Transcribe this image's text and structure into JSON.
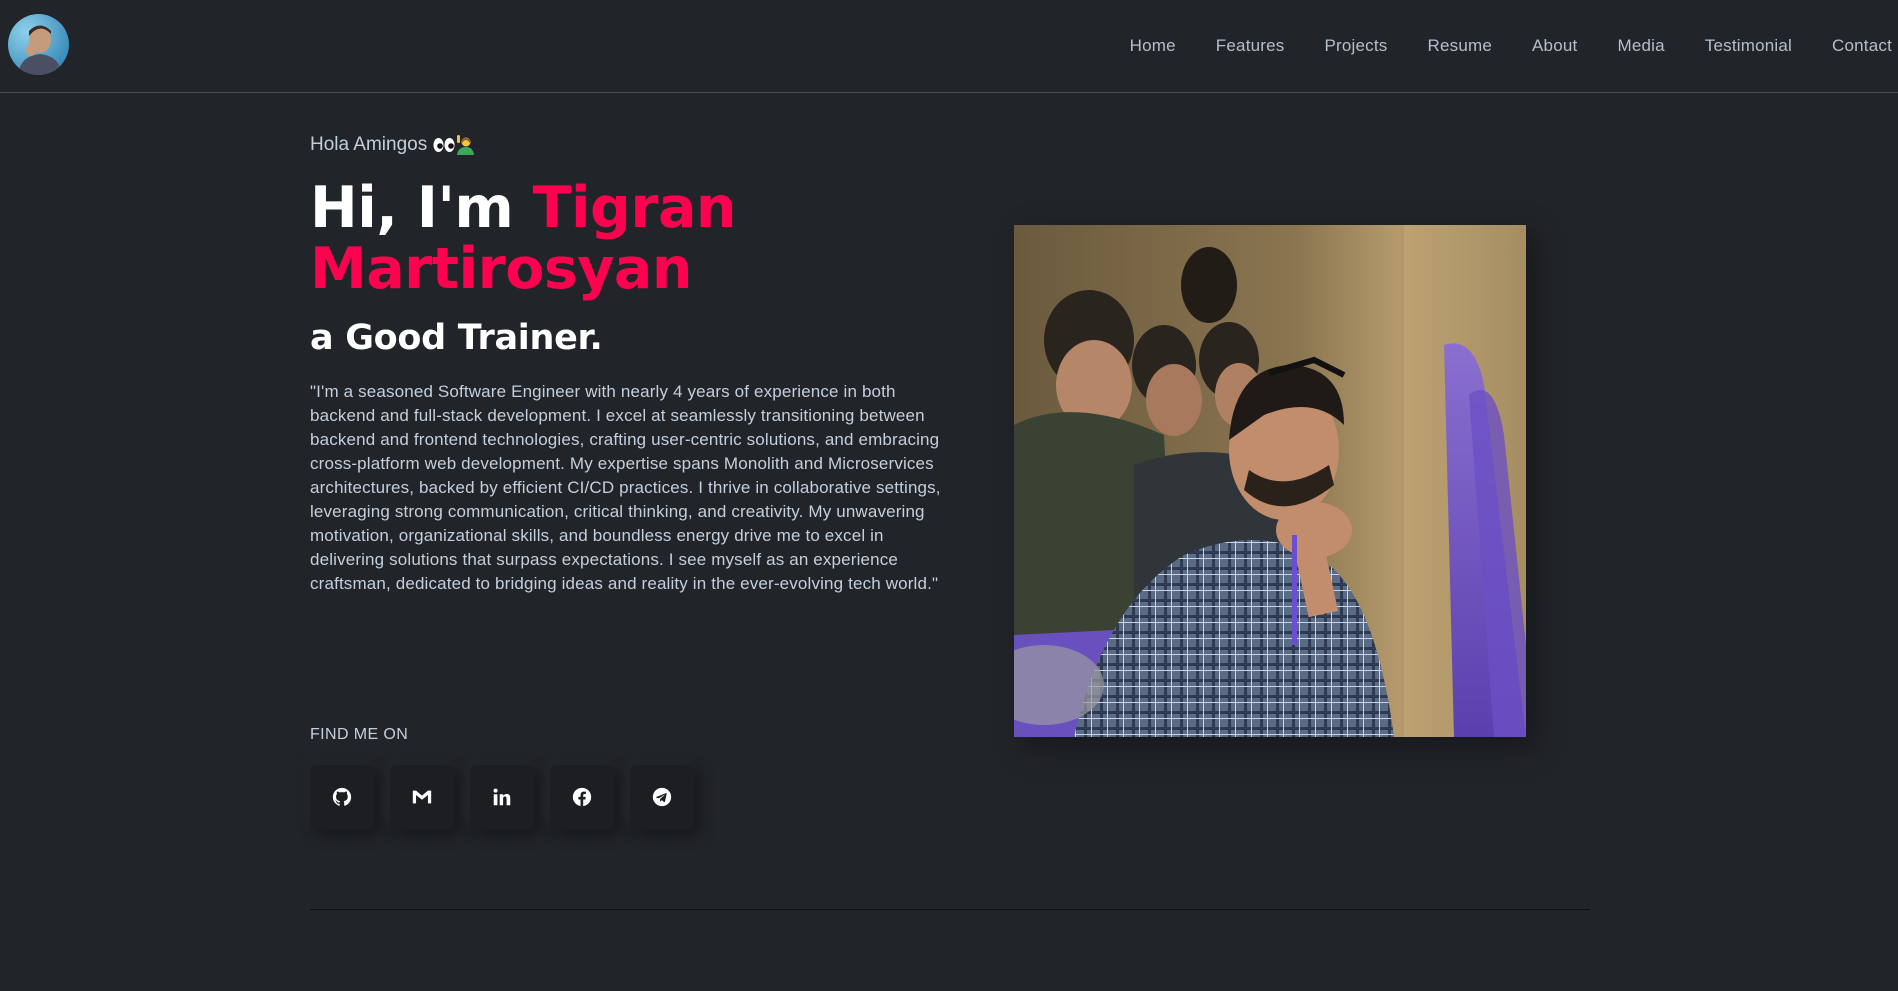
{
  "header": {
    "avatar_alt": "profile avatar",
    "nav": [
      {
        "label": "Home"
      },
      {
        "label": "Features"
      },
      {
        "label": "Projects"
      },
      {
        "label": "Resume"
      },
      {
        "label": "About"
      },
      {
        "label": "Media"
      },
      {
        "label": "Testimonial"
      },
      {
        "label": "Contact"
      }
    ]
  },
  "hero": {
    "greeting": "Hola Amingos",
    "greeting_icons": [
      "eyes-icon",
      "person-raising-hand-icon"
    ],
    "title_prefix": "Hi, I'm ",
    "title_name": "Tigran Martirosyan",
    "subtitle": "a Good Trainer.",
    "description": "\"I'm a seasoned Software Engineer with nearly 4 years of experience in both backend and full-stack development. I excel at seamlessly transitioning between backend and frontend technologies, crafting user-centric solutions, and embracing cross-platform web development. My expertise spans Monolith and Microservices architectures, backed by efficient CI/CD practices. I thrive in collaborative settings, leveraging strong communication, critical thinking, and creativity. My unwavering motivation, organizational skills, and boundless energy drive me to excel in delivering solutions that surpass expectations. I see myself as an experience craftsman, dedicated to bridging ideas and reality in the ever-evolving tech world.\"",
    "find_me_label": "FIND ME ON",
    "socials": [
      {
        "icon": "github-icon"
      },
      {
        "icon": "gmail-icon"
      },
      {
        "icon": "linkedin-icon"
      },
      {
        "icon": "facebook-icon"
      },
      {
        "icon": "telegram-icon"
      }
    ],
    "photo_alt": "man in plaid shirt listening at a lecture"
  },
  "colors": {
    "background": "#212428",
    "accent": "#ff014f",
    "text": "#c4cfde",
    "heading": "#ffffff"
  }
}
